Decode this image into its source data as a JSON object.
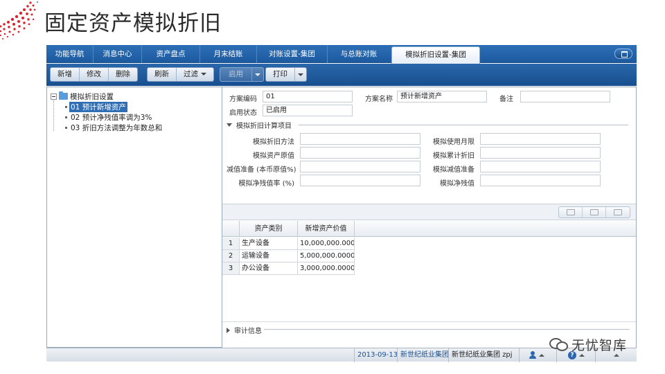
{
  "slide": {
    "title": "固定资产模拟折旧"
  },
  "tabs": [
    {
      "label": "功能导航"
    },
    {
      "label": "消息中心"
    },
    {
      "label": "资产盘点"
    },
    {
      "label": "月末结账"
    },
    {
      "label": "对账设置-集团"
    },
    {
      "label": "与总账对账"
    },
    {
      "label": "模拟折旧设置-集团",
      "active": true
    }
  ],
  "toolbar": {
    "add": "新增",
    "edit": "修改",
    "delete": "删除",
    "refresh": "刷新",
    "filter": "过滤",
    "enable": "启用",
    "print": "打印"
  },
  "tree": {
    "root": "模拟折旧设置",
    "items": [
      {
        "label": "01 预计新增资产",
        "selected": true
      },
      {
        "label": "02 预计净残值率调为3%"
      },
      {
        "label": "03 折旧方法调整为年数总和"
      }
    ]
  },
  "form": {
    "code_label": "方案编码",
    "code_value": "01",
    "name_label": "方案名称",
    "name_value": "预计新增资产",
    "remark_label": "备注",
    "remark_value": "",
    "status_label": "启用状态",
    "status_value": "已启用",
    "section_title": "模拟折旧计算项目",
    "fields": {
      "method": "模拟折旧方法",
      "life": "模拟使用月限",
      "original_value": "模拟资产原值",
      "accum_dep": "模拟累计折旧",
      "impairment_ratio": "减值准备 (本币原值%)",
      "impairment": "模拟减值准备",
      "residual_rate": "模拟净残值率 (%)",
      "residual_value": "模拟净残值"
    }
  },
  "grid": {
    "columns": [
      "资产类别",
      "新增资产价值"
    ],
    "rows": [
      {
        "index": "1",
        "category": "生产设备",
        "value": "10,000,000.000..."
      },
      {
        "index": "2",
        "category": "运输设备",
        "value": "5,000,000.0000..."
      },
      {
        "index": "3",
        "category": "办公设备",
        "value": "3,000,000.0000..."
      }
    ]
  },
  "audit": {
    "title": "审计信息"
  },
  "status": {
    "date": "2013-09-13",
    "org": "新世纪纸业集团",
    "org_user": "新世纪纸业集团",
    "user": "zpj"
  },
  "watermark": {
    "text": "无忧智库"
  },
  "colors": {
    "accent": "#1d5aa0",
    "selected": "#2f6eb5"
  }
}
